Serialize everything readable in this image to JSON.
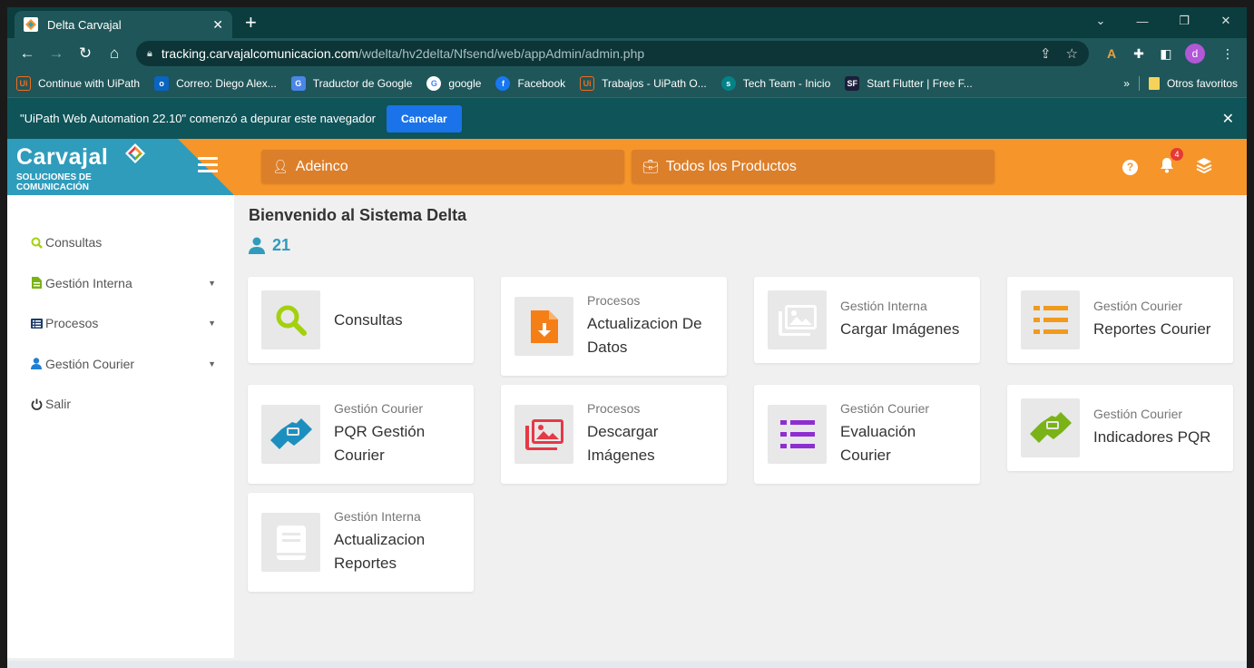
{
  "browser": {
    "tab_title": "Delta Carvajal",
    "url_host": "tracking.carvajalcomunicacion.com",
    "url_path": "/wdelta/hv2delta/Nfsend/web/appAdmin/admin.php",
    "avatar_letter": "d"
  },
  "bookmarks": [
    {
      "label": "Continue with UiPath",
      "icon": "uipath-icon"
    },
    {
      "label": "Correo: Diego Alex...",
      "icon": "outlook-icon"
    },
    {
      "label": "Traductor de Google",
      "icon": "translate-icon"
    },
    {
      "label": "google",
      "icon": "google-icon"
    },
    {
      "label": "Facebook",
      "icon": "facebook-icon"
    },
    {
      "label": "Trabajos - UiPath O...",
      "icon": "uipath-icon"
    },
    {
      "label": "Tech Team - Inicio",
      "icon": "sharepoint-icon"
    },
    {
      "label": "Start Flutter | Free F...",
      "icon": "sf-icon"
    }
  ],
  "bookmarks_more": "»",
  "bookmarks_other": "Otros favoritos",
  "infobar": {
    "message": "\"UiPath Web Automation 22.10\" comenzó a depurar este navegador",
    "cancel_label": "Cancelar"
  },
  "header": {
    "brand_name": "Carvajal",
    "brand_sub1": "SOLUCIONES DE",
    "brand_sub2": "COMUNICACIÓN",
    "client_selector": "Adeinco",
    "product_selector": "Todos los Productos",
    "notification_count": "4"
  },
  "sidebar": {
    "items": [
      {
        "label": "Consultas"
      },
      {
        "label": "Gestión Interna"
      },
      {
        "label": "Procesos"
      },
      {
        "label": "Gestión Courier"
      },
      {
        "label": "Salir"
      }
    ]
  },
  "main": {
    "welcome": "Bienvenido al Sistema Delta",
    "user_count": "21",
    "cards": [
      {
        "category": "",
        "title_line1": "Consultas",
        "title_line2": "",
        "icon": "search-icon"
      },
      {
        "category": "Procesos",
        "title_line1": "Actualizacion De",
        "title_line2": "Datos",
        "icon": "file-download-icon"
      },
      {
        "category": "Gestión Interna",
        "title_line1": "Cargar Imágenes",
        "title_line2": "",
        "icon": "images-icon"
      },
      {
        "category": "Gestión Courier",
        "title_line1": "Reportes Courier",
        "title_line2": "",
        "icon": "list-icon"
      },
      {
        "category": "Gestión Courier",
        "title_line1": "PQR Gestión",
        "title_line2": "Courier",
        "icon": "handshake-icon"
      },
      {
        "category": "Procesos",
        "title_line1": "Descargar",
        "title_line2": "Imágenes",
        "icon": "images-icon"
      },
      {
        "category": "Gestión Courier",
        "title_line1": "Evaluación",
        "title_line2": "Courier",
        "icon": "list-icon"
      },
      {
        "category": "Gestión Courier",
        "title_line1": "Indicadores PQR",
        "title_line2": "",
        "icon": "handshake-icon"
      },
      {
        "category": "Gestión Interna",
        "title_line1": "Actualizacion",
        "title_line2": "Reportes",
        "icon": "book-icon"
      }
    ]
  },
  "colors": {
    "header_orange": "#f6952a",
    "brand_blue": "#2f9cbc",
    "consultas_green": "#a3d10d",
    "procesos_orange": "#f57f17",
    "courier_orange": "#f09a1e",
    "pqr_blue": "#1d8fbf",
    "descargar_red": "#e53945",
    "evaluacion_purple": "#8e2ed0",
    "indicadores_green": "#7ab317"
  }
}
